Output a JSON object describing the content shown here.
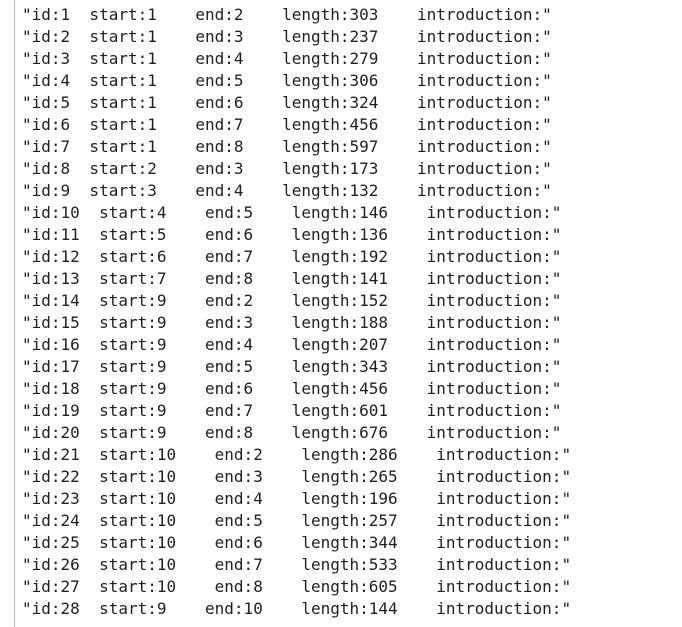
{
  "lines": [
    "\"id:1  start:1    end:2    length:303    introduction:\"",
    "\"id:2  start:1    end:3    length:237    introduction:\"",
    "\"id:3  start:1    end:4    length:279    introduction:\"",
    "\"id:4  start:1    end:5    length:306    introduction:\"",
    "\"id:5  start:1    end:6    length:324    introduction:\"",
    "\"id:6  start:1    end:7    length:456    introduction:\"",
    "\"id:7  start:1    end:8    length:597    introduction:\"",
    "\"id:8  start:2    end:3    length:173    introduction:\"",
    "\"id:9  start:3    end:4    length:132    introduction:\"",
    "\"id:10  start:4    end:5    length:146    introduction:\"",
    "\"id:11  start:5    end:6    length:136    introduction:\"",
    "\"id:12  start:6    end:7    length:192    introduction:\"",
    "\"id:13  start:7    end:8    length:141    introduction:\"",
    "\"id:14  start:9    end:2    length:152    introduction:\"",
    "\"id:15  start:9    end:3    length:188    introduction:\"",
    "\"id:16  start:9    end:4    length:207    introduction:\"",
    "\"id:17  start:9    end:5    length:343    introduction:\"",
    "\"id:18  start:9    end:6    length:456    introduction:\"",
    "\"id:19  start:9    end:7    length:601    introduction:\"",
    "\"id:20  start:9    end:8    length:676    introduction:\"",
    "\"id:21  start:10    end:2    length:286    introduction:\"",
    "\"id:22  start:10    end:3    length:265    introduction:\"",
    "\"id:23  start:10    end:4    length:196    introduction:\"",
    "\"id:24  start:10    end:5    length:257    introduction:\"",
    "\"id:25  start:10    end:6    length:344    introduction:\"",
    "\"id:26  start:10    end:7    length:533    introduction:\"",
    "\"id:27  start:10    end:8    length:605    introduction:\"",
    "\"id:28  start:9    end:10    length:144    introduction:\""
  ]
}
